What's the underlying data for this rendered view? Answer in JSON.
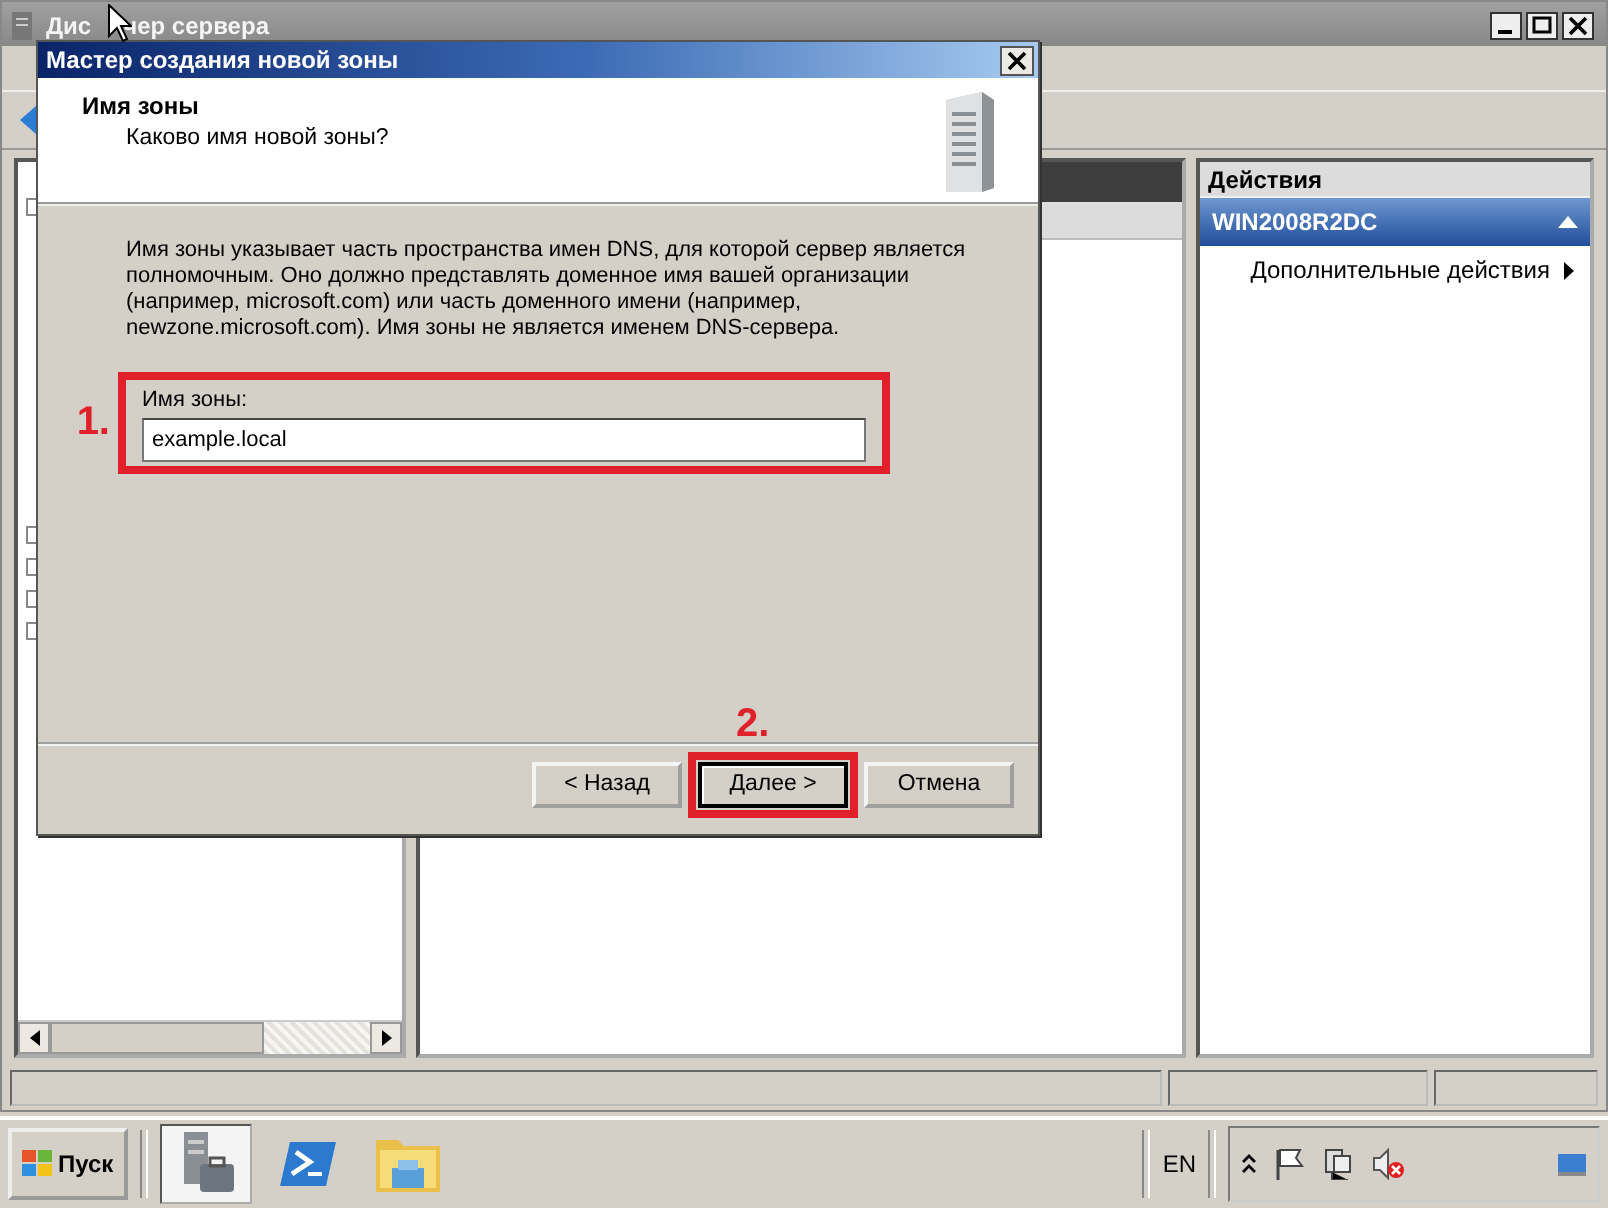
{
  "main_window": {
    "title_parts": [
      "Дис",
      "чер сервера"
    ]
  },
  "actions_pane": {
    "title": "Действия",
    "section": {
      "title": "WIN2008R2DC",
      "expanded": true
    },
    "items": [
      {
        "label": "Дополнительные действия"
      }
    ]
  },
  "dialog": {
    "title": "Мастер создания новой зоны",
    "heading": "Имя зоны",
    "subheading": "Каково имя новой зоны?",
    "description": "Имя зоны указывает часть пространства имен DNS, для которой сервер является полномочным. Оно должно представлять доменное имя вашей организации (например, microsoft.com) или часть доменного имени (например, newzone.microsoft.com). Имя зоны не является именем DNS-сервера.",
    "field": {
      "label": "Имя зоны:",
      "value": "example.local"
    },
    "buttons": [
      {
        "label": "< Назад",
        "default": false
      },
      {
        "label": "Далее >",
        "default": true
      },
      {
        "label": "Отмена",
        "default": false
      }
    ]
  },
  "annotations": [
    "1.",
    "2."
  ],
  "taskbar": {
    "start": "Пуск",
    "language": "EN"
  }
}
